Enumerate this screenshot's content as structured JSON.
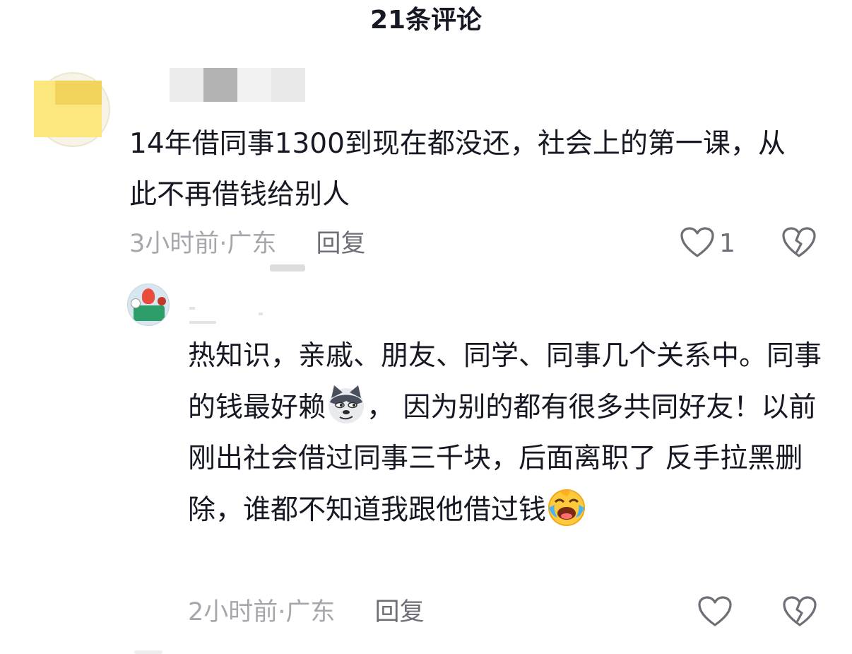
{
  "header": {
    "title": "21条评论"
  },
  "comments": [
    {
      "text": "14年借同事1300到现在都没还，社会上的第一课，从此不再借钱给别人",
      "time": "3小时前",
      "separator": " · ",
      "location": "广东",
      "reply_label": "回复",
      "like_count": "1",
      "like_icon": "heart-outline-icon",
      "dislike_icon": "broken-heart-icon"
    },
    {
      "text_part1": "热知识，亲戚、朋友、同学、同事几个关系中。同事的钱最好赖",
      "text_part2": "， 因为别的都有很多共同好友！以前刚出社会借过同事三千块，后面离职了 反手拉黑删除，谁都不知道我跟他借过钱",
      "emoji_1": "sly-wolf-emoji",
      "emoji_2": "crying-laughing-emoji",
      "time": "2小时前",
      "separator": " · ",
      "location": "广东",
      "reply_label": "回复",
      "like_icon": "heart-outline-icon",
      "dislike_icon": "broken-heart-icon"
    }
  ],
  "colors": {
    "text_primary": "#161823",
    "text_secondary": "#a6a7ad",
    "action_gray": "#6e6f76",
    "avatar_mosaic": "#fbe77e"
  }
}
